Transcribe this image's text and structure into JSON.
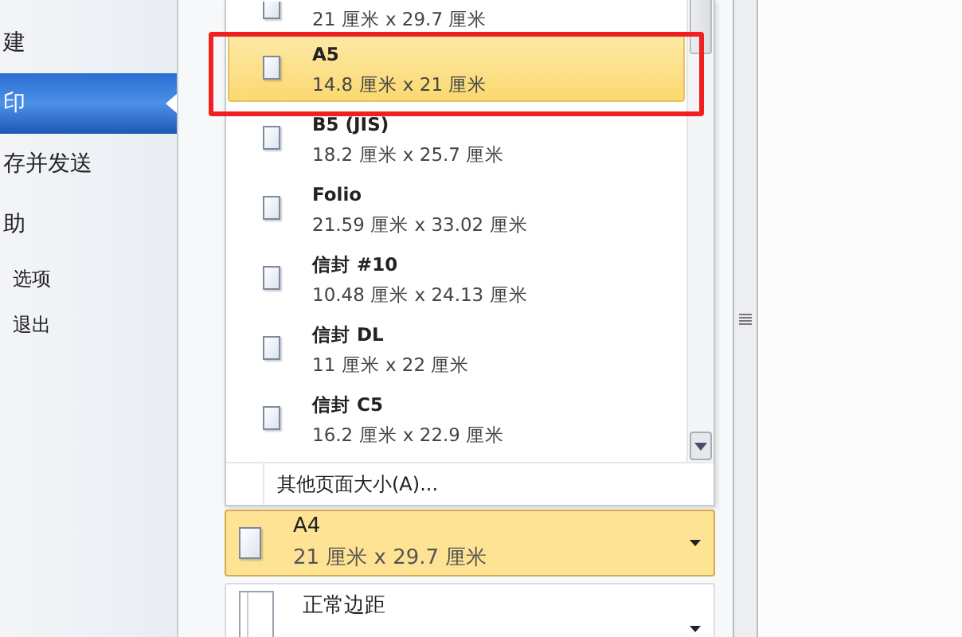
{
  "sidebar": {
    "items": [
      {
        "label": "建",
        "selected": false,
        "kind": "large"
      },
      {
        "label": "印",
        "selected": true,
        "kind": "large"
      },
      {
        "label": "存并发送",
        "selected": false,
        "kind": "large"
      },
      {
        "label": "助",
        "selected": false,
        "kind": "large"
      },
      {
        "label": "选项",
        "selected": false,
        "kind": "small"
      },
      {
        "label": "退出",
        "selected": false,
        "kind": "small"
      }
    ]
  },
  "paper_list": {
    "items": [
      {
        "size": "21 厘米 x 29.7 厘米",
        "selected": false
      },
      {
        "name": "A5",
        "size": "14.8 厘米 x 21 厘米",
        "selected": true
      },
      {
        "name": "B5 (JIS)",
        "size": "18.2 厘米 x 25.7 厘米",
        "selected": false
      },
      {
        "name": "Folio",
        "size": "21.59 厘米 x 33.02 厘米",
        "selected": false
      },
      {
        "name": "信封 #10",
        "size": "10.48 厘米 x 24.13 厘米",
        "selected": false
      },
      {
        "name": "信封 DL",
        "size": "11 厘米 x 22 厘米",
        "selected": false
      },
      {
        "name": "信封 C5",
        "size": "16.2 厘米 x 22.9 厘米",
        "selected": false
      }
    ],
    "more": "其他页面大小(A)..."
  },
  "paper_size": {
    "name": "A4",
    "size": "21 厘米 x 29.7 厘米"
  },
  "margins": {
    "name": "正常边距"
  }
}
